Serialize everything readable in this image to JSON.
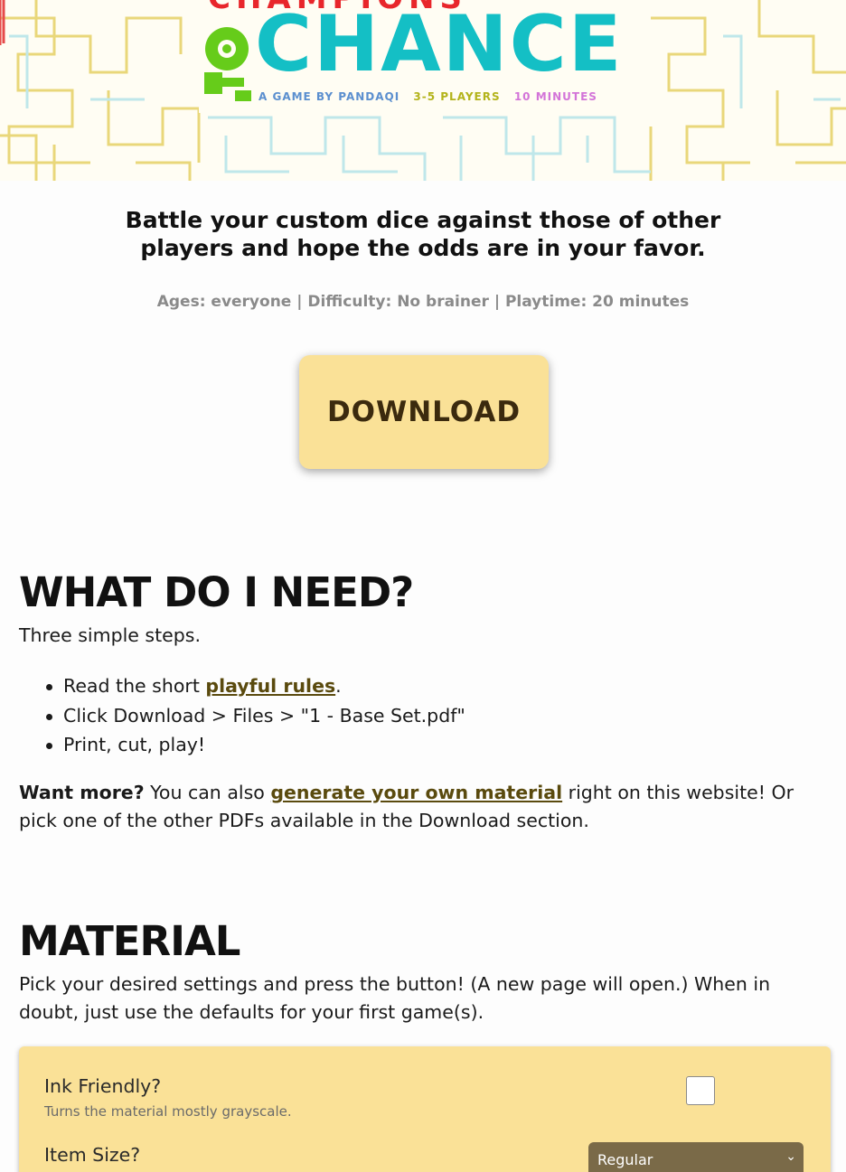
{
  "header": {
    "logo_top_text": "CHAMPIONS",
    "logo_main_text": "CHANCE",
    "byline_studio": "A GAME BY PANDAQI",
    "byline_players": "3-5 PLAYERS",
    "byline_time": "10 MINUTES"
  },
  "intro": {
    "tagline": "Battle your custom dice against those of other players and hope the odds are in your favor.",
    "meta": "Ages: everyone | Difficulty: No brainer | Playtime: 20 minutes",
    "download_label": "DOWNLOAD"
  },
  "need": {
    "heading": "WHAT DO I NEED?",
    "intro": "Three simple steps.",
    "step1_before": "Read the short ",
    "step1_link": "playful rules",
    "step1_after": ".",
    "step2": "Click Download > Files > \"1 - Base Set.pdf\"",
    "step3": "Print, cut, play!",
    "more_bold": "Want more?",
    "more_before": " You can also ",
    "more_link": "generate your own material",
    "more_after": " right on this website! Or pick one of the other PDFs available in the Download section."
  },
  "material": {
    "heading": "MATERIAL",
    "intro": "Pick your desired settings and press the button! (A new page will open.) When in doubt, just use the defaults for your first game(s).",
    "ink_label": "Ink Friendly?",
    "ink_help": "Turns the material mostly grayscale.",
    "ink_checked": false,
    "size_label": "Item Size?",
    "size_value": "Regular"
  },
  "colors": {
    "accent": "#fae197",
    "link": "#5a4a0e",
    "logo_teal": "#14bfc5",
    "logo_red": "#e8262b",
    "logo_green": "#66cc1a"
  }
}
